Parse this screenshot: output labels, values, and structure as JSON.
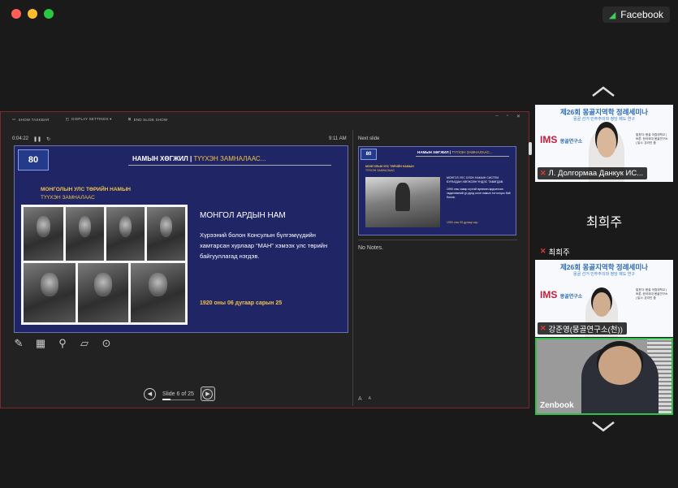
{
  "app": {
    "share_badge": "Facebook"
  },
  "presenter": {
    "toolbar": [
      "SHOW TASKBAR",
      "DISPLAY SETTINGS ▾",
      "END SLIDE SHOW"
    ],
    "timer": "0:04:22",
    "clock": "9:11 AM",
    "next_label": "Next slide",
    "notes": "No Notes.",
    "slide_counter": "Slide 6 of 25",
    "slide_progress": 0.24,
    "font_controls": [
      "A",
      "A"
    ],
    "slide": {
      "logo": "80",
      "header": "НАМЫН ХӨГЖИЛ | ",
      "header_sub": "ТҮҮХЭН ЗАМНАЛААС...",
      "title_line1": "МОНГОЛЫН УЛС ТӨРИЙН НАМЫН",
      "title_line2": "ТҮҮХЭН ЗАМНАЛААС",
      "body_title": "МОНГОЛ АРДЫН НАМ",
      "body": "Хүрээний болон Консулын бүлгэмүүдийн хамтарсан хурлаар “МАН” хэмээх улс төрийн байгууллагад нэгдэв.",
      "date": "1920 оны 06 дугаар сарын 25"
    },
    "next_slide": {
      "logo": "80",
      "header": "НАМЫН ХӨГЖИЛ | ",
      "header_sub": "ТҮҮХЭН ЗАМНАЛААС...",
      "title_line1": "МОНГОЛЫН УЛС ТӨРИЙН НАМЫН",
      "title_line2": "ТҮҮХЭН ЗАМНАЛААС",
      "body1": "МОНГОЛ УЛС ОЛОН НАМЫН СИСТЕМ БУРАЛДАН ХӨГЖСӨН ҮНДЭС ТАВИГДАВ.",
      "body2": "1990 оны хавар хүчтэй өрнөсөн ардчилсан хөдөлгөөний үр дүнд олон намын тогтолцоо бий болов.",
      "date": "1990 оны 05 дугаар сар"
    }
  },
  "participants": [
    {
      "name": "Л. Долгормаа Данкук ИС...",
      "seminar_title": "제26회 몽골지역학 정례세미나",
      "seminar_sub": "몽골 선거 민주주의와 정당 제도 연구",
      "ims": "IMS",
      "ims_tag": "몽골연구소",
      "right_text": "발표자: 몽골 국립대학교 | 토론: 한국외대 몽골연구소 | 일시: 온라인 줌"
    },
    {
      "name": "최희주",
      "big_name": "최희주"
    },
    {
      "name": "강준영(몽골연구소(천))",
      "seminar_title": "제26회 몽골지역학 정례세미나",
      "seminar_sub": "몽골 선거 민주주의와 정당 제도 연구",
      "ims": "IMS",
      "ims_tag": "몽골연구소",
      "right_text": "발표자: 몽골 국립대학교 | 토론: 한국외대 몽골연구소 | 일시: 온라인 줌"
    },
    {
      "name": "Zenbook"
    }
  ]
}
